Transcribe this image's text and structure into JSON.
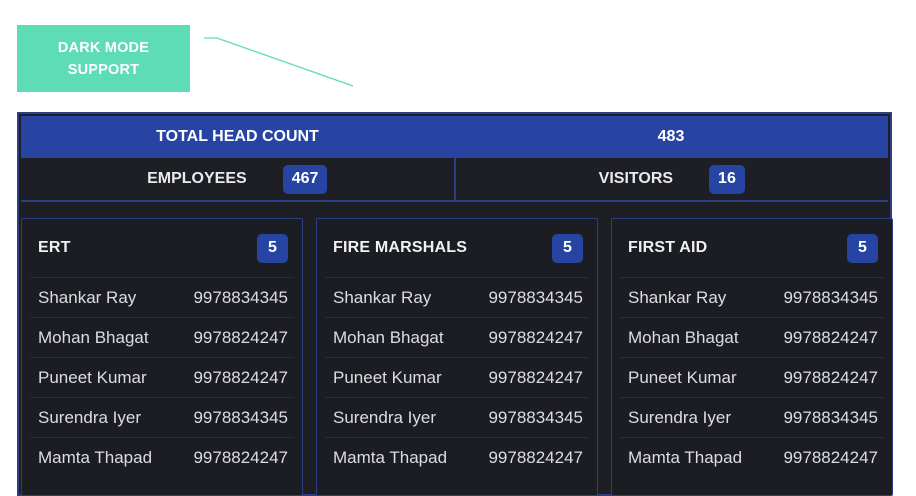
{
  "callout": {
    "text": "DARK MODE SUPPORT",
    "color": "#5ddcb6"
  },
  "summary": {
    "total_label": "TOTAL HEAD COUNT",
    "total_value": "483",
    "employees_label": "EMPLOYEES",
    "employees_value": "467",
    "visitors_label": "VISITORS",
    "visitors_value": "16"
  },
  "theme": {
    "background": "#1e1f24",
    "accent": "#2744a3",
    "border": "#2b3f85"
  },
  "groups": [
    {
      "title": "ERT",
      "count": "5",
      "people": [
        {
          "name": "Shankar Ray",
          "phone": "9978834345"
        },
        {
          "name": "Mohan Bhagat",
          "phone": "9978824247"
        },
        {
          "name": "Puneet Kumar",
          "phone": "9978824247"
        },
        {
          "name": "Surendra Iyer",
          "phone": "9978834345"
        },
        {
          "name": "Mamta Thapad",
          "phone": "9978824247"
        }
      ]
    },
    {
      "title": "FIRE MARSHALS",
      "count": "5",
      "people": [
        {
          "name": "Shankar Ray",
          "phone": "9978834345"
        },
        {
          "name": "Mohan Bhagat",
          "phone": "9978824247"
        },
        {
          "name": "Puneet Kumar",
          "phone": "9978824247"
        },
        {
          "name": "Surendra Iyer",
          "phone": "9978834345"
        },
        {
          "name": "Mamta Thapad",
          "phone": "9978824247"
        }
      ]
    },
    {
      "title": "FIRST AID",
      "count": "5",
      "people": [
        {
          "name": "Shankar Ray",
          "phone": "9978834345"
        },
        {
          "name": "Mohan Bhagat",
          "phone": "9978824247"
        },
        {
          "name": "Puneet Kumar",
          "phone": "9978824247"
        },
        {
          "name": "Surendra Iyer",
          "phone": "9978834345"
        },
        {
          "name": "Mamta Thapad",
          "phone": "9978824247"
        }
      ]
    }
  ]
}
